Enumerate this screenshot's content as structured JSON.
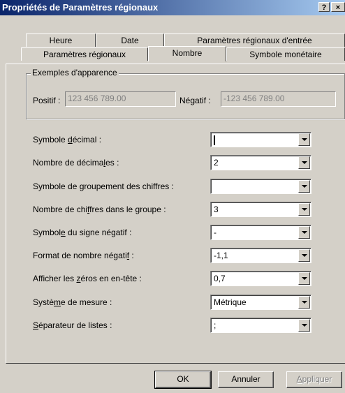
{
  "window": {
    "title": "Propriétés de Paramètres régionaux",
    "help_label": "?",
    "close_label": "×"
  },
  "tabs": {
    "row1": [
      "Heure",
      "Date",
      "Paramètres régionaux d'entrée"
    ],
    "row2": [
      "Paramètres régionaux",
      "Nombre",
      "Symbole monétaire"
    ],
    "active": "Nombre"
  },
  "examples": {
    "legend": "Exemples d'apparence",
    "positive_label": "Positif :",
    "positive_value": "123 456 789.00",
    "negative_label": "Négatif :",
    "negative_value": "-123 456 789.00"
  },
  "settings": [
    {
      "label": "Symbole décimal :",
      "value": ""
    },
    {
      "label": "Nombre de décimales :",
      "value": "2"
    },
    {
      "label": "Symbole de groupement des chiffres :",
      "value": ""
    },
    {
      "label": "Nombre de chiffres dans le groupe :",
      "value": "3"
    },
    {
      "label": "Symbole du signe négatif :",
      "value": "-"
    },
    {
      "label": "Format de nombre négatif :",
      "value": "-1,1"
    },
    {
      "label": "Afficher les zéros en en-tête :",
      "value": "0,7"
    },
    {
      "label": "Système de mesure :",
      "value": "Métrique"
    },
    {
      "label": "Séparateur de listes :",
      "value": ";"
    }
  ],
  "buttons": {
    "ok": "OK",
    "cancel": "Annuler",
    "apply": "Appliquer"
  }
}
